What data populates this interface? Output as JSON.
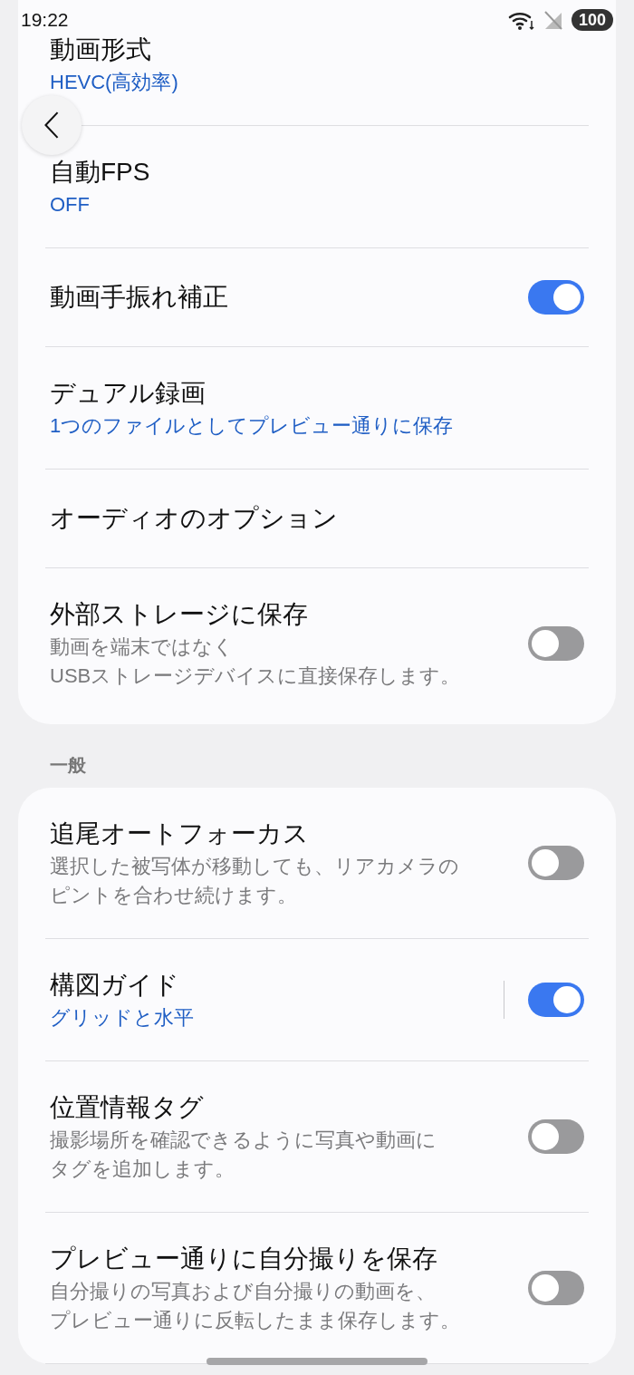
{
  "status_bar": {
    "time": "19:22",
    "battery": "100"
  },
  "sections": [
    {
      "items": [
        {
          "kind": "link",
          "title": "動画形式",
          "value": "HEVC(高効率)"
        },
        {
          "kind": "link",
          "title": "自動FPS",
          "value": "OFF"
        },
        {
          "kind": "toggle",
          "title": "動画手振れ補正",
          "on": true
        },
        {
          "kind": "link",
          "title": "デュアル録画",
          "value": "1つのファイルとしてプレビュー通りに保存"
        },
        {
          "kind": "link",
          "title": "オーディオのオプション"
        },
        {
          "kind": "toggle",
          "title": "外部ストレージに保存",
          "description": [
            "動画を端末ではなく",
            "USBストレージデバイスに直接保存します。"
          ],
          "on": false
        }
      ]
    },
    {
      "header": "一般",
      "items": [
        {
          "kind": "toggle",
          "title": "追尾オートフォーカス",
          "description": [
            "選択した被写体が移動しても、リアカメラの",
            "ピントを合わせ続けます。"
          ],
          "on": false
        },
        {
          "kind": "split-toggle",
          "title": "構図ガイド",
          "value": "グリッドと水平",
          "on": true
        },
        {
          "kind": "toggle",
          "title": "位置情報タグ",
          "description": [
            "撮影場所を確認できるように写真や動画に",
            "タグを追加します。"
          ],
          "on": false
        },
        {
          "kind": "toggle",
          "title": "プレビュー通りに自分撮りを保存",
          "description": [
            "自分撮りの写真および自分撮りの動画を、",
            "プレビュー通りに反転したまま保存します。"
          ],
          "on": false
        }
      ]
    }
  ]
}
